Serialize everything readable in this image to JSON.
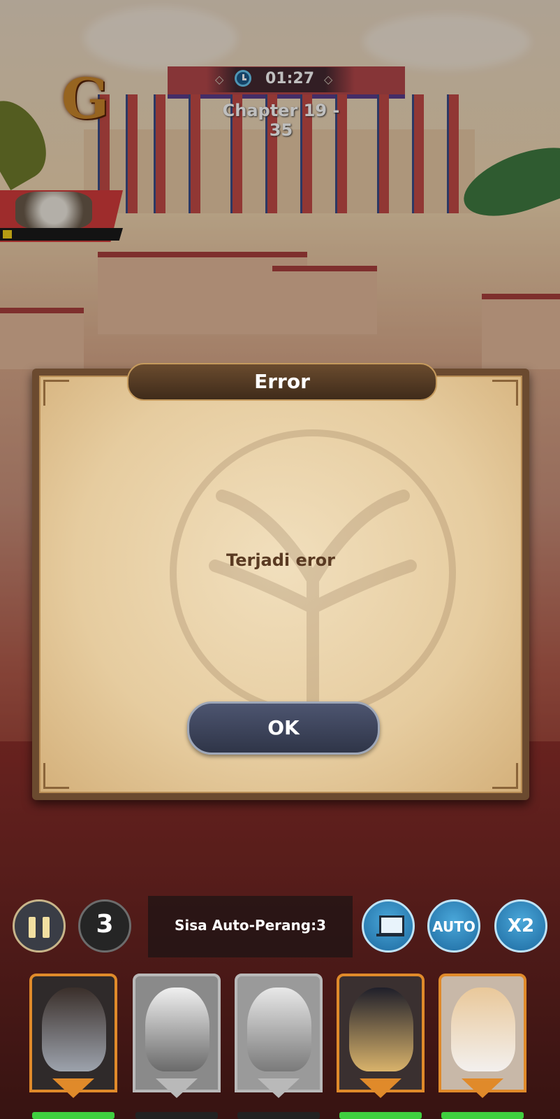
{
  "top": {
    "timer": "01:27",
    "chapter": "Chapter 19 - 35",
    "logo_letter": "G",
    "boss_hp": 0.08
  },
  "dialog": {
    "title": "Error",
    "message": "Terjadi eror",
    "ok_label": "OK"
  },
  "hud": {
    "battle_count": "3",
    "auto_battle_remaining": "Sisa Auto-Perang:3",
    "auto_label": "AUTO",
    "speed_label": "X2"
  },
  "heroes": [
    {
      "name": "hero-1",
      "state": "active"
    },
    {
      "name": "hero-2",
      "state": "inactive"
    },
    {
      "name": "hero-3",
      "state": "inactive"
    },
    {
      "name": "hero-4",
      "state": "active"
    },
    {
      "name": "hero-5",
      "state": "active"
    }
  ],
  "colors": {
    "accent_blue": "#1d6aa0",
    "frame_gold": "#e08a2a",
    "frame_silver": "#b9b9b9",
    "hp_green": "#3fcf3f"
  }
}
